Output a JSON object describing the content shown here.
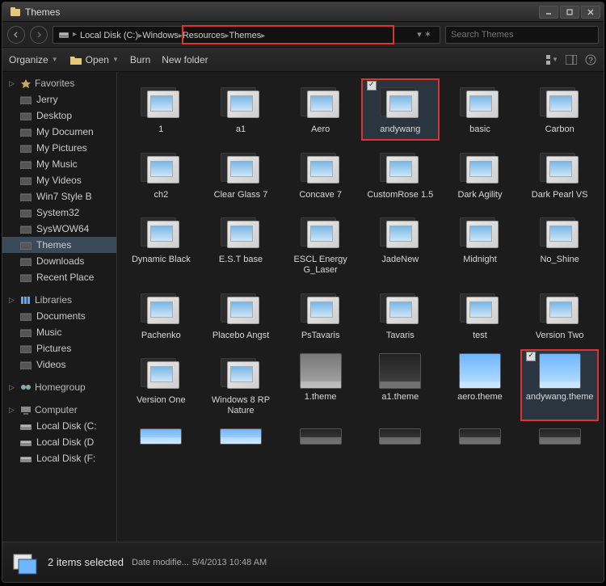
{
  "window": {
    "title": "Themes"
  },
  "nav": {
    "crumbs": [
      "Local Disk (C:)",
      "Windows",
      "Resources",
      "Themes"
    ],
    "search_placeholder": "Search Themes"
  },
  "toolbar": {
    "organize": "Organize",
    "open": "Open",
    "burn": "Burn",
    "newfolder": "New folder"
  },
  "sidebar": {
    "favorites": {
      "label": "Favorites",
      "items": [
        "Jerry",
        "Desktop",
        "My Documen",
        "My Pictures",
        "My Music",
        "My Videos",
        "Win7 Style B",
        "System32",
        "SysWOW64",
        "Themes",
        "Downloads",
        "Recent Place"
      ]
    },
    "libraries": {
      "label": "Libraries",
      "items": [
        "Documents",
        "Music",
        "Pictures",
        "Videos"
      ]
    },
    "homegroup": {
      "label": "Homegroup"
    },
    "computer": {
      "label": "Computer",
      "items": [
        "Local Disk (C:",
        "Local Disk (D",
        "Local Disk (F:"
      ]
    }
  },
  "items": [
    {
      "label": "1",
      "type": "folder"
    },
    {
      "label": "a1",
      "type": "folder"
    },
    {
      "label": "Aero",
      "type": "folder"
    },
    {
      "label": "andywang",
      "type": "folder",
      "selected": true,
      "highlight": true
    },
    {
      "label": "basic",
      "type": "folder"
    },
    {
      "label": "Carbon",
      "type": "folder"
    },
    {
      "label": "ch2",
      "type": "folder"
    },
    {
      "label": "Clear Glass 7",
      "type": "folder"
    },
    {
      "label": "Concave 7",
      "type": "folder"
    },
    {
      "label": "CustomRose 1.5",
      "type": "folder"
    },
    {
      "label": "Dark Agility",
      "type": "folder"
    },
    {
      "label": "Dark Pearl VS",
      "type": "folder"
    },
    {
      "label": "Dynamic Black",
      "type": "folder"
    },
    {
      "label": "E.S.T  base",
      "type": "folder"
    },
    {
      "label": "ESCL Energy G_Laser",
      "type": "folder"
    },
    {
      "label": "JadeNew",
      "type": "folder"
    },
    {
      "label": "Midnight",
      "type": "folder"
    },
    {
      "label": "No_Shine",
      "type": "folder"
    },
    {
      "label": "Pachenko",
      "type": "folder"
    },
    {
      "label": "Placebo Angst",
      "type": "folder"
    },
    {
      "label": "PsTavaris",
      "type": "folder"
    },
    {
      "label": "Tavaris",
      "type": "folder"
    },
    {
      "label": "test",
      "type": "folder"
    },
    {
      "label": "Version Two",
      "type": "folder"
    },
    {
      "label": "Version One",
      "type": "folder"
    },
    {
      "label": "Windows 8 RP Nature",
      "type": "folder"
    },
    {
      "label": "1.theme",
      "type": "theme",
      "variant": "gray"
    },
    {
      "label": "a1.theme",
      "type": "theme",
      "variant": "dark"
    },
    {
      "label": "aero.theme",
      "type": "theme",
      "variant": "light"
    },
    {
      "label": "andywang.theme",
      "type": "theme",
      "variant": "light",
      "selected": true,
      "highlight": true
    }
  ],
  "partial_items": [
    {
      "type": "theme",
      "variant": "light"
    },
    {
      "type": "theme",
      "variant": "light"
    },
    {
      "type": "theme",
      "variant": "dark"
    },
    {
      "type": "theme",
      "variant": "dark"
    },
    {
      "type": "theme",
      "variant": "dark"
    },
    {
      "type": "theme",
      "variant": "dark"
    }
  ],
  "status": {
    "main": "2 items selected",
    "date_label": "Date modifie...",
    "date_value": "5/4/2013 10:48 AM"
  },
  "colors": {
    "highlight": "#d33"
  },
  "active_side_item": "Themes"
}
